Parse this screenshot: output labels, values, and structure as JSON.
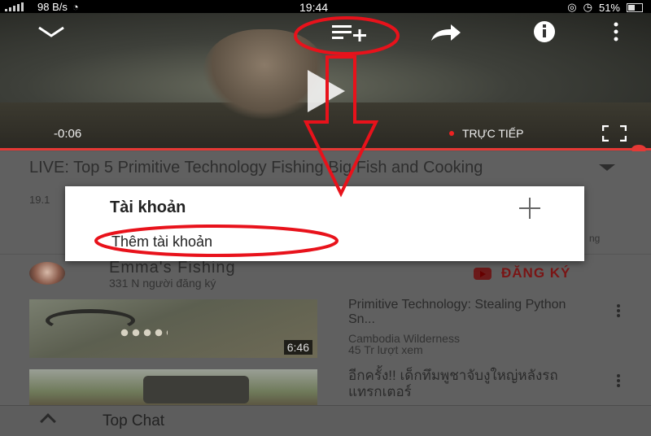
{
  "status_bar": {
    "network_speed": "98 B/s",
    "time": "19:44",
    "battery": "51%"
  },
  "player": {
    "elapsed": "-0:06",
    "live_label": "TRỰC TIẾP"
  },
  "video": {
    "title": "LIVE: Top 5 Primitive Technology Fishing Big Fish and Cooking",
    "views_partial": "19.1",
    "partial_right_text": "ng"
  },
  "channel": {
    "name": "Emma's Fishing",
    "subscribers": "331 N người đăng ký",
    "subscribe_label": "ĐĂNG KÝ"
  },
  "recommended": [
    {
      "title": "Primitive Technology: Stealing Python Sn...",
      "channel": "Cambodia Wilderness",
      "views": "45 Tr lượt xem",
      "duration": "6:46"
    },
    {
      "title": "อีกครั้ง!! เด็กทึมพูชาจับงูใหญ่หลังรถแทรกเตอร์"
    }
  ],
  "bottom_bar": {
    "label": "Top Chat"
  },
  "dialog": {
    "heading": "Tài khoản",
    "item": "Thêm tài khoản"
  },
  "annotation": {
    "color": "#e8121b"
  }
}
